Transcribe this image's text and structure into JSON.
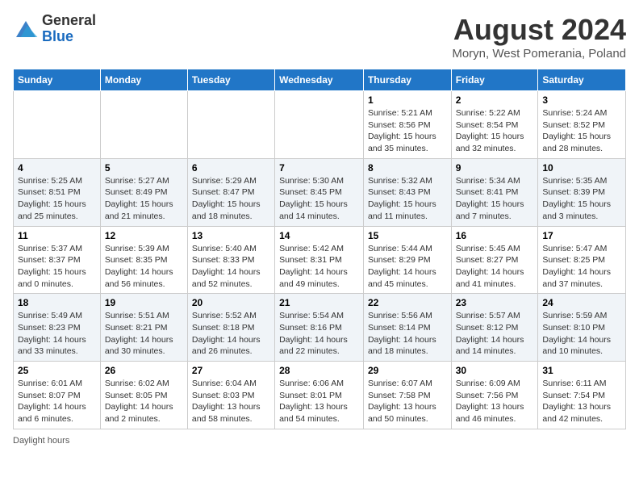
{
  "header": {
    "logo_general": "General",
    "logo_blue": "Blue",
    "month_year": "August 2024",
    "location": "Moryn, West Pomerania, Poland"
  },
  "days_of_week": [
    "Sunday",
    "Monday",
    "Tuesday",
    "Wednesday",
    "Thursday",
    "Friday",
    "Saturday"
  ],
  "weeks": [
    [
      {
        "day": "",
        "info": ""
      },
      {
        "day": "",
        "info": ""
      },
      {
        "day": "",
        "info": ""
      },
      {
        "day": "",
        "info": ""
      },
      {
        "day": "1",
        "info": "Sunrise: 5:21 AM\nSunset: 8:56 PM\nDaylight: 15 hours and 35 minutes."
      },
      {
        "day": "2",
        "info": "Sunrise: 5:22 AM\nSunset: 8:54 PM\nDaylight: 15 hours and 32 minutes."
      },
      {
        "day": "3",
        "info": "Sunrise: 5:24 AM\nSunset: 8:52 PM\nDaylight: 15 hours and 28 minutes."
      }
    ],
    [
      {
        "day": "4",
        "info": "Sunrise: 5:25 AM\nSunset: 8:51 PM\nDaylight: 15 hours and 25 minutes."
      },
      {
        "day": "5",
        "info": "Sunrise: 5:27 AM\nSunset: 8:49 PM\nDaylight: 15 hours and 21 minutes."
      },
      {
        "day": "6",
        "info": "Sunrise: 5:29 AM\nSunset: 8:47 PM\nDaylight: 15 hours and 18 minutes."
      },
      {
        "day": "7",
        "info": "Sunrise: 5:30 AM\nSunset: 8:45 PM\nDaylight: 15 hours and 14 minutes."
      },
      {
        "day": "8",
        "info": "Sunrise: 5:32 AM\nSunset: 8:43 PM\nDaylight: 15 hours and 11 minutes."
      },
      {
        "day": "9",
        "info": "Sunrise: 5:34 AM\nSunset: 8:41 PM\nDaylight: 15 hours and 7 minutes."
      },
      {
        "day": "10",
        "info": "Sunrise: 5:35 AM\nSunset: 8:39 PM\nDaylight: 15 hours and 3 minutes."
      }
    ],
    [
      {
        "day": "11",
        "info": "Sunrise: 5:37 AM\nSunset: 8:37 PM\nDaylight: 15 hours and 0 minutes."
      },
      {
        "day": "12",
        "info": "Sunrise: 5:39 AM\nSunset: 8:35 PM\nDaylight: 14 hours and 56 minutes."
      },
      {
        "day": "13",
        "info": "Sunrise: 5:40 AM\nSunset: 8:33 PM\nDaylight: 14 hours and 52 minutes."
      },
      {
        "day": "14",
        "info": "Sunrise: 5:42 AM\nSunset: 8:31 PM\nDaylight: 14 hours and 49 minutes."
      },
      {
        "day": "15",
        "info": "Sunrise: 5:44 AM\nSunset: 8:29 PM\nDaylight: 14 hours and 45 minutes."
      },
      {
        "day": "16",
        "info": "Sunrise: 5:45 AM\nSunset: 8:27 PM\nDaylight: 14 hours and 41 minutes."
      },
      {
        "day": "17",
        "info": "Sunrise: 5:47 AM\nSunset: 8:25 PM\nDaylight: 14 hours and 37 minutes."
      }
    ],
    [
      {
        "day": "18",
        "info": "Sunrise: 5:49 AM\nSunset: 8:23 PM\nDaylight: 14 hours and 33 minutes."
      },
      {
        "day": "19",
        "info": "Sunrise: 5:51 AM\nSunset: 8:21 PM\nDaylight: 14 hours and 30 minutes."
      },
      {
        "day": "20",
        "info": "Sunrise: 5:52 AM\nSunset: 8:18 PM\nDaylight: 14 hours and 26 minutes."
      },
      {
        "day": "21",
        "info": "Sunrise: 5:54 AM\nSunset: 8:16 PM\nDaylight: 14 hours and 22 minutes."
      },
      {
        "day": "22",
        "info": "Sunrise: 5:56 AM\nSunset: 8:14 PM\nDaylight: 14 hours and 18 minutes."
      },
      {
        "day": "23",
        "info": "Sunrise: 5:57 AM\nSunset: 8:12 PM\nDaylight: 14 hours and 14 minutes."
      },
      {
        "day": "24",
        "info": "Sunrise: 5:59 AM\nSunset: 8:10 PM\nDaylight: 14 hours and 10 minutes."
      }
    ],
    [
      {
        "day": "25",
        "info": "Sunrise: 6:01 AM\nSunset: 8:07 PM\nDaylight: 14 hours and 6 minutes."
      },
      {
        "day": "26",
        "info": "Sunrise: 6:02 AM\nSunset: 8:05 PM\nDaylight: 14 hours and 2 minutes."
      },
      {
        "day": "27",
        "info": "Sunrise: 6:04 AM\nSunset: 8:03 PM\nDaylight: 13 hours and 58 minutes."
      },
      {
        "day": "28",
        "info": "Sunrise: 6:06 AM\nSunset: 8:01 PM\nDaylight: 13 hours and 54 minutes."
      },
      {
        "day": "29",
        "info": "Sunrise: 6:07 AM\nSunset: 7:58 PM\nDaylight: 13 hours and 50 minutes."
      },
      {
        "day": "30",
        "info": "Sunrise: 6:09 AM\nSunset: 7:56 PM\nDaylight: 13 hours and 46 minutes."
      },
      {
        "day": "31",
        "info": "Sunrise: 6:11 AM\nSunset: 7:54 PM\nDaylight: 13 hours and 42 minutes."
      }
    ]
  ],
  "footer": {
    "daylight_hours_label": "Daylight hours"
  }
}
